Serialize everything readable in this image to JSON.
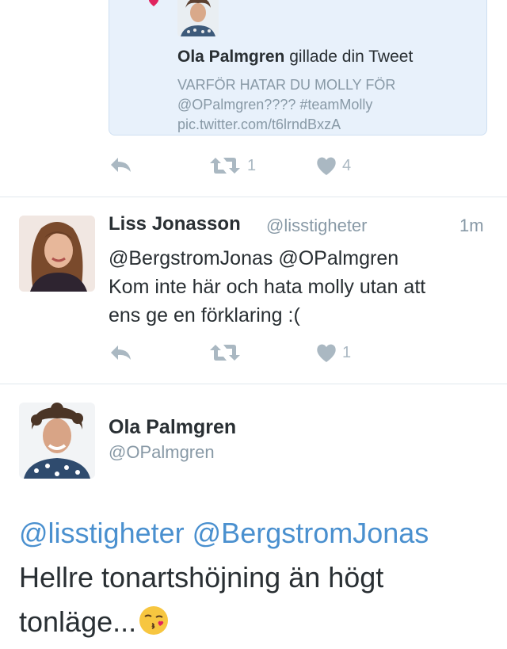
{
  "notification": {
    "actor_name": "Ola Palmgren",
    "action_text": "gillade din Tweet",
    "quoted_line1": "VARFÖR HATAR DU MOLLY FÖR",
    "quoted_line2": "@OPalmgren???? #teamMolly",
    "quoted_line3": "pic.twitter.com/t6lrndBxzA",
    "retweet_count": "1",
    "like_count": "4"
  },
  "tweet": {
    "name": "Liss Jonasson",
    "handle": "@lisstigheter",
    "time": "1m",
    "line1": "@BergstromJonas @OPalmgren",
    "line2": "Kom inte här och hata molly utan att",
    "line3": "ens ge en förklaring :(",
    "like_count": "1"
  },
  "detail": {
    "name": "Ola Palmgren",
    "handle": "@OPalmgren",
    "mention1": "@lisstigheter",
    "mention2": "@BergstromJonas",
    "line2": "Hellre tonartshöjning än högt",
    "line3": "tonläge..."
  },
  "colors": {
    "link": "#4a90cf",
    "muted": "#8899a6",
    "icon": "#aab8c2",
    "like_heart": "#e0245e",
    "card_bg": "#e8f1fb"
  },
  "icons": [
    "heart-icon",
    "reply-icon",
    "retweet-icon",
    "like-icon",
    "kiss-emoji-icon"
  ]
}
